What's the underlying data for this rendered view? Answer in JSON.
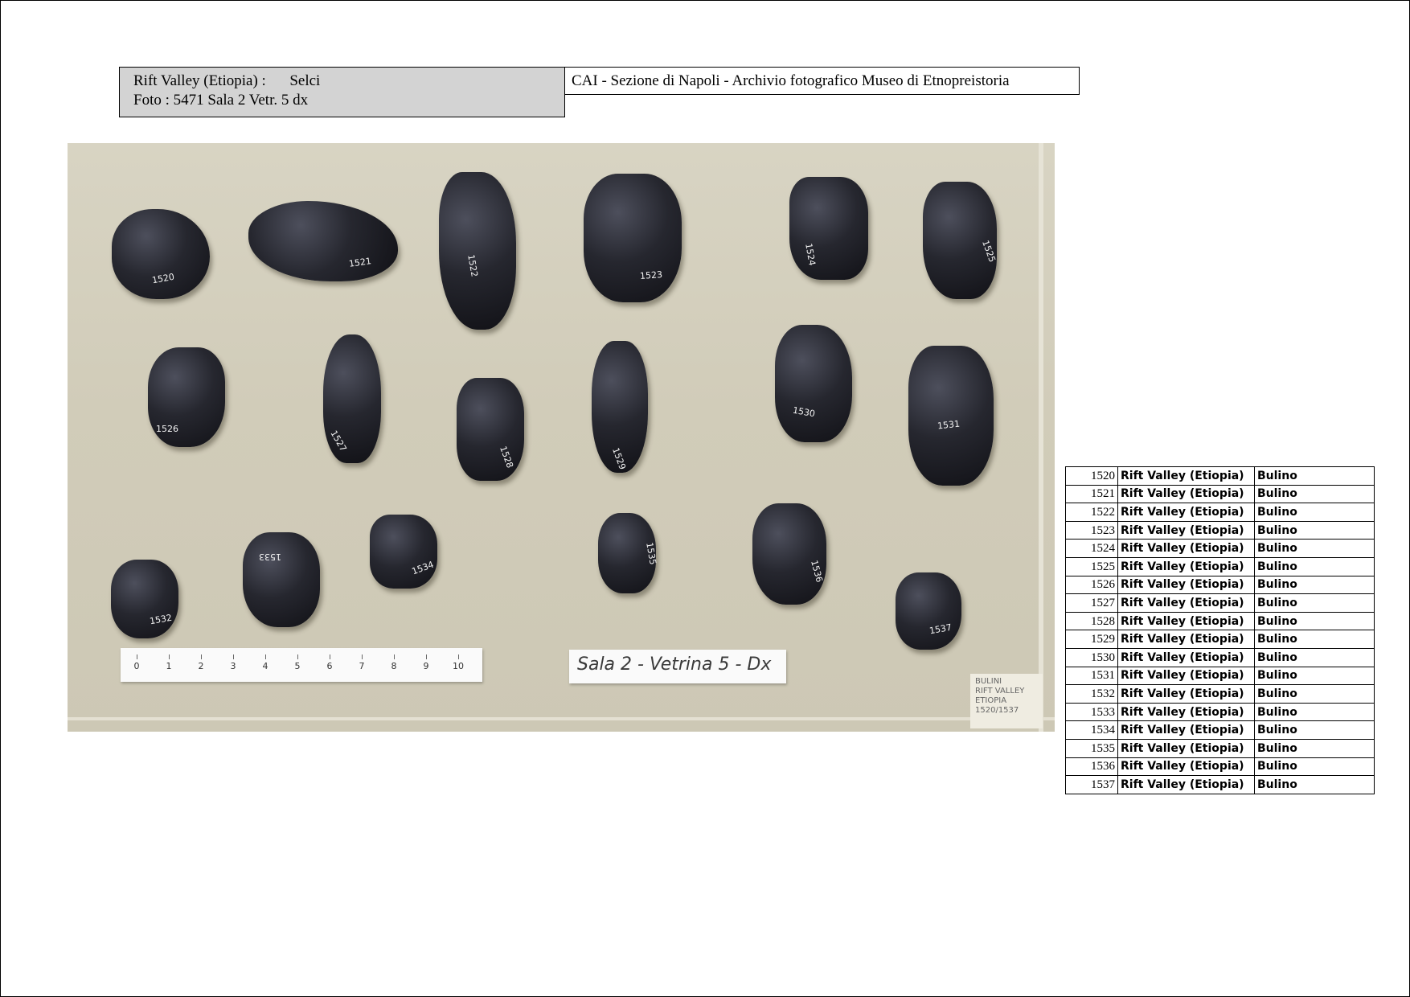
{
  "header": {
    "left_line1_place": "Rift Valley   (Etiopia)  :",
    "left_line1_material": "Selci",
    "left_line2": "Foto :  5471   Sala  2   Vetr.  5 dx",
    "right_title": "CAI - Sezione di Napoli  - Archivio fotografico Museo di Etnopreistoria"
  },
  "photo": {
    "stone_labels": [
      "1520",
      "1521",
      "1522",
      "1523",
      "1524",
      "1525",
      "1526",
      "1527",
      "1528",
      "1529",
      "1530",
      "1531",
      "1532",
      "1533",
      "1534",
      "1535",
      "1536",
      "1537"
    ],
    "ruler_numbers": [
      "0",
      "1",
      "2",
      "3",
      "4",
      "5",
      "6",
      "7",
      "8",
      "9",
      "10"
    ],
    "room_label": "Sala 2 - Vetrina 5 - Dx",
    "card_lines": [
      "BULINI",
      "RIFT VALLEY",
      "ETIOPIA",
      "1520/1537"
    ]
  },
  "table": {
    "rows": [
      {
        "num": "1520",
        "location": "Rift Valley (Etiopia)",
        "type": "Bulino"
      },
      {
        "num": "1521",
        "location": "Rift Valley (Etiopia)",
        "type": "Bulino"
      },
      {
        "num": "1522",
        "location": "Rift Valley (Etiopia)",
        "type": "Bulino"
      },
      {
        "num": "1523",
        "location": "Rift Valley (Etiopia)",
        "type": "Bulino"
      },
      {
        "num": "1524",
        "location": "Rift Valley (Etiopia)",
        "type": "Bulino"
      },
      {
        "num": "1525",
        "location": "Rift Valley (Etiopia)",
        "type": "Bulino"
      },
      {
        "num": "1526",
        "location": "Rift Valley (Etiopia)",
        "type": "Bulino"
      },
      {
        "num": "1527",
        "location": "Rift Valley (Etiopia)",
        "type": "Bulino"
      },
      {
        "num": "1528",
        "location": "Rift Valley (Etiopia)",
        "type": "Bulino"
      },
      {
        "num": "1529",
        "location": "Rift Valley (Etiopia)",
        "type": "Bulino"
      },
      {
        "num": "1530",
        "location": "Rift Valley (Etiopia)",
        "type": "Bulino"
      },
      {
        "num": "1531",
        "location": "Rift Valley (Etiopia)",
        "type": "Bulino"
      },
      {
        "num": "1532",
        "location": "Rift Valley (Etiopia)",
        "type": "Bulino"
      },
      {
        "num": "1533",
        "location": "Rift Valley (Etiopia)",
        "type": "Bulino"
      },
      {
        "num": "1534",
        "location": "Rift Valley (Etiopia)",
        "type": "Bulino"
      },
      {
        "num": "1535",
        "location": "Rift Valley (Etiopia)",
        "type": "Bulino"
      },
      {
        "num": "1536",
        "location": "Rift Valley (Etiopia)",
        "type": "Bulino"
      },
      {
        "num": "1537",
        "location": "Rift Valley (Etiopia)",
        "type": "Bulino"
      }
    ]
  }
}
